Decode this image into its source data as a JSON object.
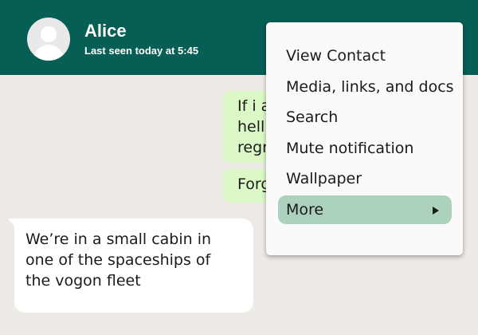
{
  "header": {
    "contact_name": "Alice",
    "last_seen": "Last seen today at 5:45",
    "background": "#075e54"
  },
  "messages": [
    {
      "direction": "outgoing",
      "lines": [
        "If i a",
        "hell",
        "regr"
      ]
    },
    {
      "direction": "outgoing",
      "lines": [
        "Forg"
      ]
    },
    {
      "direction": "incoming",
      "lines": [
        "We’re in a small cabin in",
        "one of the spaceships of",
        "the vogon fleet"
      ]
    }
  ],
  "menu": {
    "items": [
      {
        "label": "View Contact"
      },
      {
        "label": "Media, links, and docs"
      },
      {
        "label": "Search"
      },
      {
        "label": "Mute notification"
      },
      {
        "label": "Wallpaper"
      },
      {
        "label": "More",
        "active": true,
        "submenu": true
      }
    ],
    "highlight_color": "#acd2be"
  },
  "colors": {
    "chat_background": "#eeeae6",
    "outgoing_bubble": "#dcf8c6",
    "incoming_bubble": "#ffffff"
  },
  "icons": {
    "avatar": "default-avatar-icon",
    "submenu": "submenu-arrow-icon"
  }
}
